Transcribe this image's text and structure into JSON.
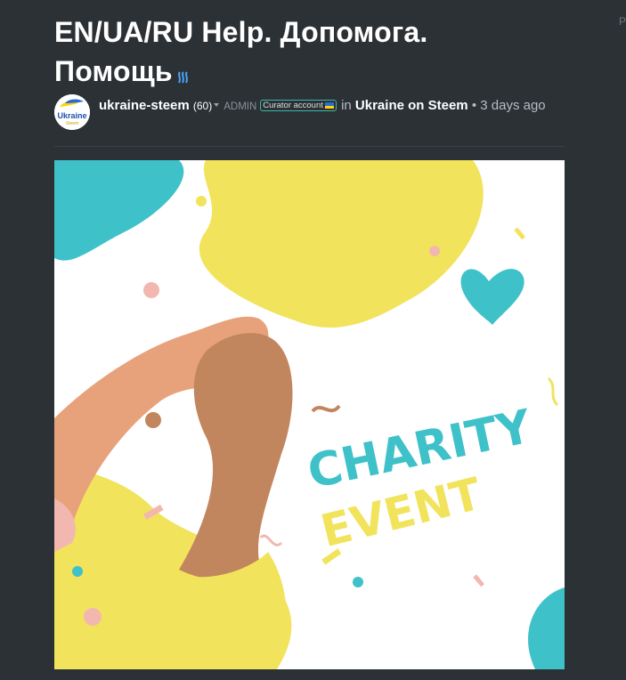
{
  "post": {
    "title": "EN/UA/RU Help. Допомога. Помощь",
    "author": "ukraine-steem",
    "reputation": "(60)",
    "role": "ADMIN",
    "badge": "Curator account",
    "in_label": "in",
    "community": "Ukraine on Steem",
    "bullet": "•",
    "time": "3 days ago",
    "avatar_text": "Ukraine",
    "avatar_subtext": "Steem"
  },
  "corner_text": "P",
  "hero_image": {
    "line1": "CHARITY",
    "line2": "EVENT"
  },
  "colors": {
    "background": "#2c3136",
    "title": "#ffffff",
    "teal": "#3fc1c9",
    "yellow": "#f2e35c",
    "light_skin": "#e8a27b",
    "dark_skin": "#c2865f"
  }
}
